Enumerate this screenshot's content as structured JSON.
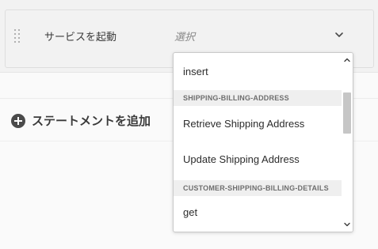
{
  "rule": {
    "service_label": "サービスを起動",
    "service_select": {
      "value": "選択"
    }
  },
  "add_statement": {
    "label": "ステートメントを追加"
  },
  "dropdown": {
    "items": [
      {
        "type": "option",
        "label": "insert"
      },
      {
        "type": "group",
        "label": "SHIPPING-BILLING-ADDRESS"
      },
      {
        "type": "option",
        "label": "Retrieve Shipping Address"
      },
      {
        "type": "option",
        "label": "Update Shipping Address"
      },
      {
        "type": "group",
        "label": "CUSTOMER-SHIPPING-BILLING-DETAILS"
      },
      {
        "type": "option",
        "label": "get"
      }
    ],
    "scroll_position": 0.25
  },
  "icons": {
    "drag": "drag-handle-icon",
    "chevron": "chevron-down-icon",
    "add": "plus-circle-icon",
    "scroll_up": "chevron-up-icon",
    "scroll_down": "chevron-down-icon"
  },
  "colors": {
    "card_bg": "#f2f2f2",
    "group_header_bg": "#efefef",
    "scroll_thumb": "#c6c6c6"
  }
}
